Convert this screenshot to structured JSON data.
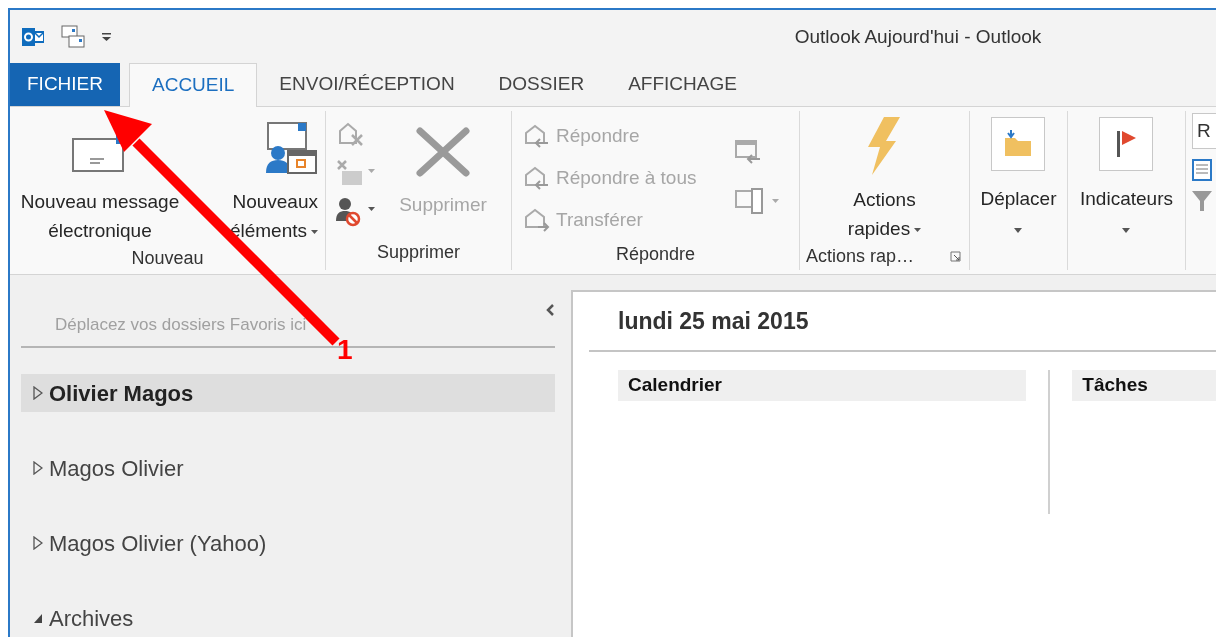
{
  "window": {
    "title": "Outlook Aujourd'hui - Outlook"
  },
  "tabs": [
    {
      "label": "FICHIER",
      "kind": "file",
      "selected": false
    },
    {
      "label": "ACCUEIL",
      "kind": "tab",
      "selected": true
    },
    {
      "label": "ENVOI/RÉCEPTION",
      "kind": "tab",
      "selected": false
    },
    {
      "label": "DOSSIER",
      "kind": "tab",
      "selected": false
    },
    {
      "label": "AFFICHAGE",
      "kind": "tab",
      "selected": false
    }
  ],
  "ribbon": {
    "nouveau": {
      "label": "Nouveau",
      "buttons": [
        {
          "lines": [
            "Nouveau message",
            "électronique"
          ],
          "disabled": false
        },
        {
          "lines": [
            "Nouveaux",
            "éléments"
          ],
          "disabled": false
        }
      ]
    },
    "supprimer": {
      "label": "Supprimer",
      "button": {
        "label": "Supprimer",
        "disabled": true
      }
    },
    "repondre": {
      "label": "Répondre",
      "buttons": [
        {
          "label": "Répondre",
          "disabled": true
        },
        {
          "label": "Répondre à tous",
          "disabled": true
        },
        {
          "label": "Transférer",
          "disabled": true
        }
      ]
    },
    "actions": {
      "label": "Actions rap…",
      "button": {
        "lines": [
          "Actions",
          "rapides"
        ]
      }
    },
    "deplacer": {
      "button": {
        "label": "Déplacer"
      }
    },
    "indicateurs": {
      "button": {
        "label": "Indicateurs"
      }
    },
    "search": {
      "value": "R"
    }
  },
  "nav": {
    "favorites_hint": "Déplacez vos dossiers Favoris ici",
    "accounts": [
      {
        "label": "Olivier Magos",
        "selected": true,
        "expanded": false
      },
      {
        "label": "Magos Olivier",
        "selected": false,
        "expanded": false
      },
      {
        "label": "Magos Olivier (Yahoo)",
        "selected": false,
        "expanded": false
      },
      {
        "label": "Archives",
        "selected": false,
        "expanded": true
      }
    ]
  },
  "today": {
    "date": "lundi 25 mai 2015",
    "sections": [
      "Calendrier",
      "Tâches"
    ]
  },
  "annotation": {
    "number": "1"
  }
}
